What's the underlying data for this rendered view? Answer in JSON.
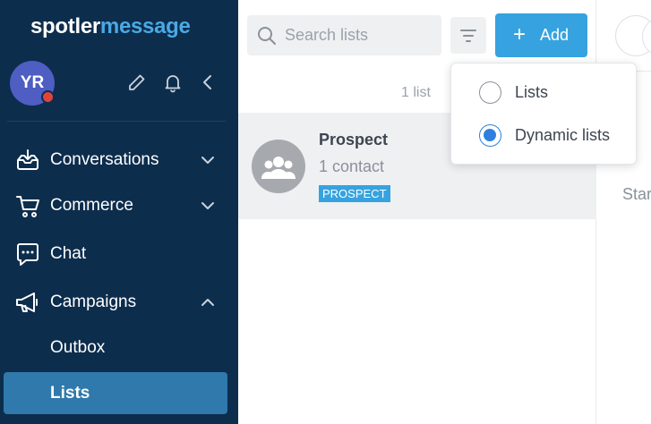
{
  "brand": {
    "part1": "spotler",
    "part2": "message"
  },
  "user": {
    "initials": "YR"
  },
  "nav": {
    "items": [
      {
        "label": "Conversations"
      },
      {
        "label": "Commerce"
      },
      {
        "label": "Chat"
      },
      {
        "label": "Campaigns"
      }
    ],
    "sub_items": [
      {
        "label": "Outbox"
      },
      {
        "label": "Lists"
      }
    ]
  },
  "search": {
    "placeholder": "Search lists"
  },
  "toolbar": {
    "add_label": "Add",
    "add_icon": "+"
  },
  "list": {
    "count": "1 list",
    "rows": [
      {
        "title": "Prospect",
        "subtitle": "1 contact",
        "badge": "PROSPECT"
      }
    ]
  },
  "dropdown": {
    "options": [
      {
        "label": "Lists",
        "checked": false
      },
      {
        "label": "Dynamic lists",
        "checked": true
      }
    ]
  },
  "right_panel": {
    "partial_text": "Star"
  },
  "colors": {
    "sidebar_bg": "#0d2d4d",
    "active_item_bg": "#2f79ad",
    "accent": "#36a3e0",
    "radio_checked": "#2f7fe0",
    "avatar_bg": "#4e5ec2",
    "notification_dot": "#e0453a"
  }
}
